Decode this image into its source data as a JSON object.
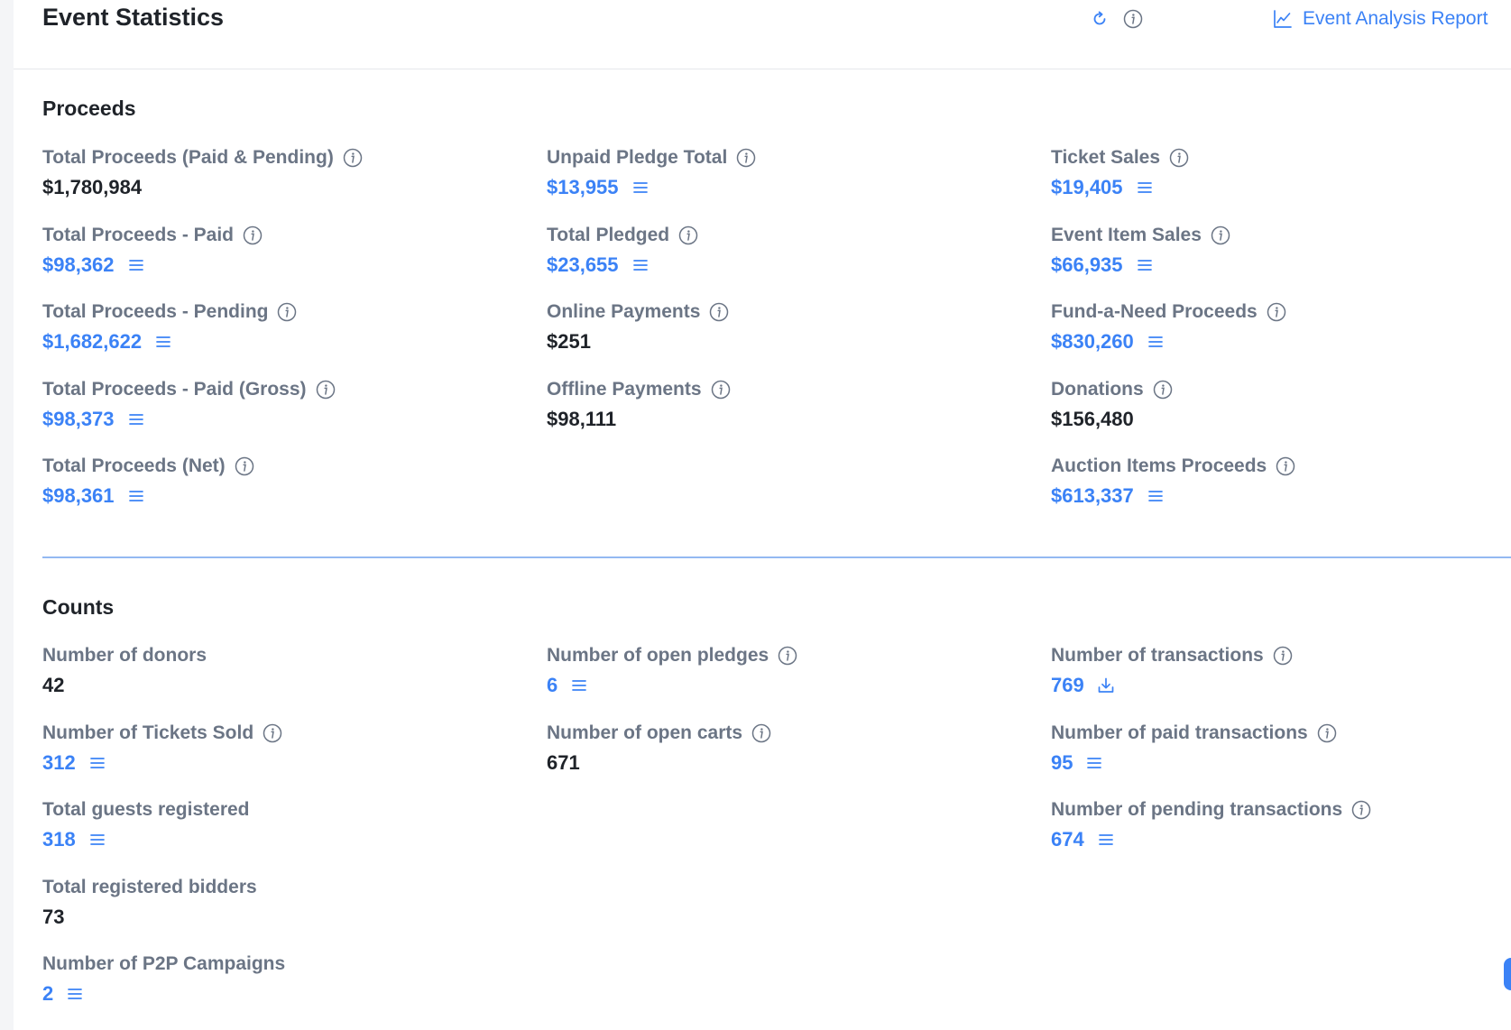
{
  "header": {
    "title": "Event Statistics",
    "report_link": "Event Analysis Report"
  },
  "proceeds": {
    "title": "Proceeds",
    "items": [
      {
        "label": "Total Proceeds (Paid & Pending)",
        "value": "$1,780,984"
      },
      {
        "label": "Total Proceeds - Paid",
        "value": "$98,362"
      },
      {
        "label": "Total Proceeds - Pending",
        "value": "$1,682,622"
      },
      {
        "label": "Total Proceeds - Paid (Gross)",
        "value": "$98,373"
      },
      {
        "label": "Total Proceeds (Net)",
        "value": "$98,361"
      },
      {
        "label": "Unpaid Pledge Total",
        "value": "$13,955"
      },
      {
        "label": "Total Pledged",
        "value": "$23,655"
      },
      {
        "label": "Online Payments",
        "value": "$251"
      },
      {
        "label": "Offline Payments",
        "value": "$98,111"
      },
      {
        "label": "Ticket Sales",
        "value": "$19,405"
      },
      {
        "label": "Event Item Sales",
        "value": "$66,935"
      },
      {
        "label": "Fund-a-Need Proceeds",
        "value": "$830,260"
      },
      {
        "label": "Donations",
        "value": "$156,480"
      },
      {
        "label": "Auction Items Proceeds",
        "value": "$613,337"
      }
    ]
  },
  "counts": {
    "title": "Counts",
    "items": [
      {
        "label": "Number of donors",
        "value": "42"
      },
      {
        "label": "Number of Tickets Sold",
        "value": "312"
      },
      {
        "label": "Total guests registered",
        "value": "318"
      },
      {
        "label": "Total registered bidders",
        "value": "73"
      },
      {
        "label": "Number of P2P Campaigns",
        "value": "2"
      },
      {
        "label": "Number of open pledges",
        "value": "6"
      },
      {
        "label": "Number of open carts",
        "value": "671"
      },
      {
        "label": "Number of transactions",
        "value": "769"
      },
      {
        "label": "Number of paid transactions",
        "value": "95"
      },
      {
        "label": "Number of pending transactions",
        "value": "674"
      }
    ]
  },
  "icons": {
    "refresh": "refresh-icon",
    "info": "info-icon",
    "chart": "line-chart-icon",
    "list": "list-icon",
    "download": "download-icon"
  },
  "colors": {
    "accent": "#3b82f6",
    "label": "#6b7585",
    "text": "#1f2329",
    "divider": "#93b9f2"
  }
}
